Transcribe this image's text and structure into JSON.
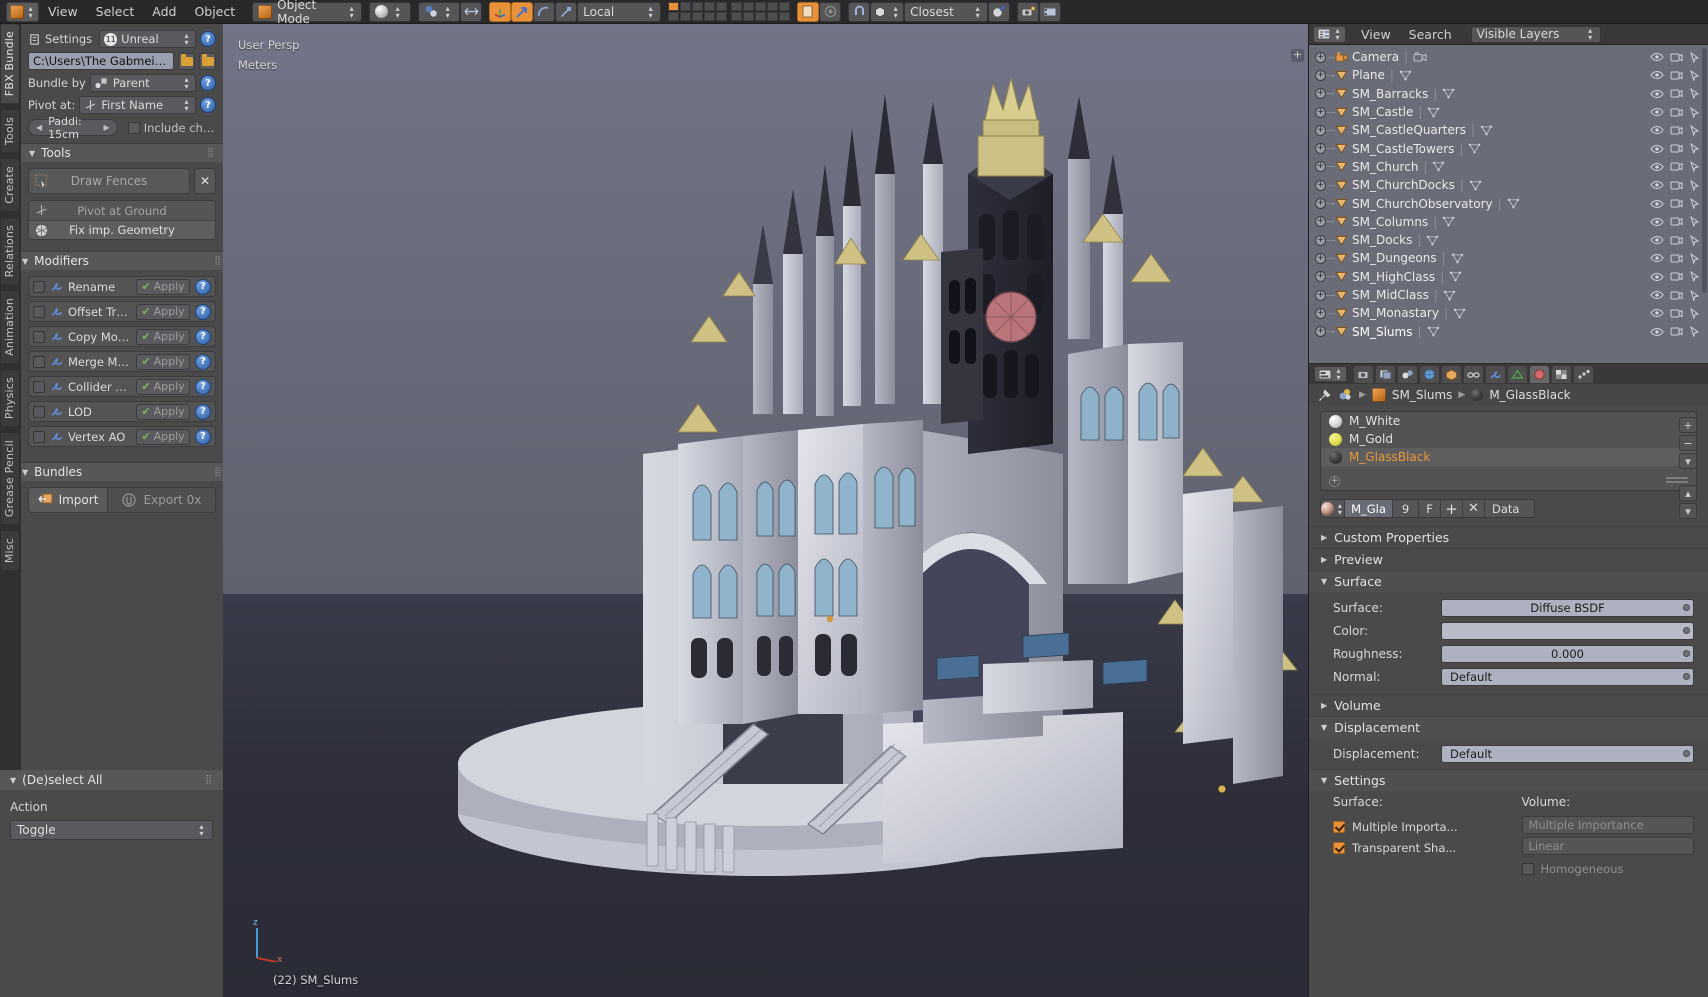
{
  "topbar": {
    "editor_icon": "object-mode-cube-icon",
    "menus": [
      "View",
      "Select",
      "Add",
      "Object"
    ],
    "mode": "Object Mode",
    "shading": "solid-shading-icon",
    "snap_mode": "Closest",
    "transform_orientation": "Local",
    "pivot_icon": "pivot-icon",
    "proportional_icon": "proportional-edit-icon",
    "magnet_icon": "magnet-icon",
    "snap_element_icon": "snap-element-icon",
    "render_icon": "render-camera-icon",
    "layers_label": "scene-layers"
  },
  "left_tabs": [
    {
      "label": "FBX Bundle",
      "selected": true
    },
    {
      "label": "Tools",
      "selected": false
    },
    {
      "label": "Create",
      "selected": false
    },
    {
      "label": "Relations",
      "selected": false
    },
    {
      "label": "Animation",
      "selected": false
    },
    {
      "label": "Physics",
      "selected": false
    },
    {
      "label": "Grease Pencil",
      "selected": false
    },
    {
      "label": "Misc",
      "selected": false
    }
  ],
  "fbx_bundle": {
    "settings_label": "Settings",
    "preset": "Unreal",
    "preset_badge": "11",
    "path": "C:\\Users\\The Gabmeister\\D...",
    "bundle_by_label": "Bundle by",
    "bundle_by": "Parent",
    "pivot_at_label": "Pivot at:",
    "pivot_at": "First Name",
    "padding": "Paddi: 15cm",
    "include_children": "Include chil...",
    "include_children_checked": false,
    "help_glyph": "?",
    "sections": {
      "tools": {
        "title": "Tools",
        "draw_fences": "Draw Fences",
        "clear_glyph": "✕",
        "pivot_at_ground": "Pivot at Ground",
        "fix_geometry": "Fix imp. Geometry"
      },
      "modifiers": {
        "title": "Modifiers",
        "apply_label": "Apply",
        "items": [
          {
            "name": "Rename",
            "checked": false
          },
          {
            "name": "Offset Trans...",
            "checked": false
          },
          {
            "name": "Copy Modifi...",
            "checked": false
          },
          {
            "name": "Merge Mesh",
            "checked": false
          },
          {
            "name": "Collider Mesh",
            "checked": false
          },
          {
            "name": "LOD",
            "checked": false
          },
          {
            "name": "Vertex AO",
            "checked": false
          }
        ]
      },
      "bundles": {
        "title": "Bundles",
        "import": "Import",
        "export": "Export 0x"
      }
    }
  },
  "operator_panel": {
    "title": "(De)select All",
    "action_label": "Action",
    "action_value": "Toggle"
  },
  "viewport": {
    "view_name": "User Persp",
    "units": "Meters",
    "status": "(22) SM_Slums",
    "background_top": "#6e7080",
    "ground": "#2f3040",
    "model": "gothic-castle-city-mesh"
  },
  "outliner": {
    "editor_icon": "outliner-editor-icon",
    "menus": [
      "View",
      "Search"
    ],
    "filter": "Visible Layers",
    "items": [
      {
        "name": "Camera",
        "type": "camera",
        "selected": false
      },
      {
        "name": "Plane",
        "type": "mesh",
        "selected": false
      },
      {
        "name": "SM_Barracks",
        "type": "mesh",
        "selected": false
      },
      {
        "name": "SM_Castle",
        "type": "mesh",
        "selected": false
      },
      {
        "name": "SM_CastleQuarters",
        "type": "mesh",
        "selected": false
      },
      {
        "name": "SM_CastleTowers",
        "type": "mesh",
        "selected": false
      },
      {
        "name": "SM_Church",
        "type": "mesh",
        "selected": false
      },
      {
        "name": "SM_ChurchDocks",
        "type": "mesh",
        "selected": false
      },
      {
        "name": "SM_ChurchObservatory",
        "type": "mesh",
        "selected": false
      },
      {
        "name": "SM_Columns",
        "type": "mesh",
        "selected": false
      },
      {
        "name": "SM_Docks",
        "type": "mesh",
        "selected": false
      },
      {
        "name": "SM_Dungeons",
        "type": "mesh",
        "selected": false
      },
      {
        "name": "SM_HighClass",
        "type": "mesh",
        "selected": false
      },
      {
        "name": "SM_MidClass",
        "type": "mesh",
        "selected": false
      },
      {
        "name": "SM_Monastary",
        "type": "mesh",
        "selected": false
      },
      {
        "name": "SM_Slums",
        "type": "mesh",
        "selected": true
      }
    ]
  },
  "properties": {
    "breadcrumb_object": "SM_Slums",
    "breadcrumb_material": "M_GlassBlack",
    "materials": [
      {
        "name": "M_White",
        "swatch": "white",
        "selected": false
      },
      {
        "name": "M_Gold",
        "swatch": "gold",
        "selected": false
      },
      {
        "name": "M_GlassBlack",
        "swatch": "black",
        "selected": true
      }
    ],
    "material_id": {
      "name": "M_Gla",
      "users": "9",
      "fake_user": "F",
      "new_glyph": "+",
      "unlink_glyph": "✕",
      "datablock": "Data"
    },
    "sections": {
      "custom_properties": {
        "title": "Custom Properties",
        "open": false
      },
      "preview": {
        "title": "Preview",
        "open": false
      },
      "surface": {
        "title": "Surface",
        "open": true,
        "surface_label": "Surface:",
        "surface_value": "Diffuse BSDF",
        "color_label": "Color:",
        "color_value": "",
        "roughness_label": "Roughness:",
        "roughness_value": "0.000",
        "normal_label": "Normal:",
        "normal_value": "Default"
      },
      "volume": {
        "title": "Volume",
        "open": false
      },
      "displacement": {
        "title": "Displacement",
        "open": true,
        "label": "Displacement:",
        "value": "Default"
      },
      "settings": {
        "title": "Settings",
        "open": true,
        "surface_col": "Surface:",
        "volume_col": "Volume:",
        "multiple_importance_surface": "Multiple Importa...",
        "multiple_importance_surface_checked": true,
        "transparent_shadows": "Transparent Sha...",
        "transparent_shadows_checked": true,
        "multiple_importance_volume": "Multiple Importance",
        "sampling": "Linear",
        "homogeneous": "Homogeneous",
        "homogeneous_checked": false
      }
    }
  }
}
